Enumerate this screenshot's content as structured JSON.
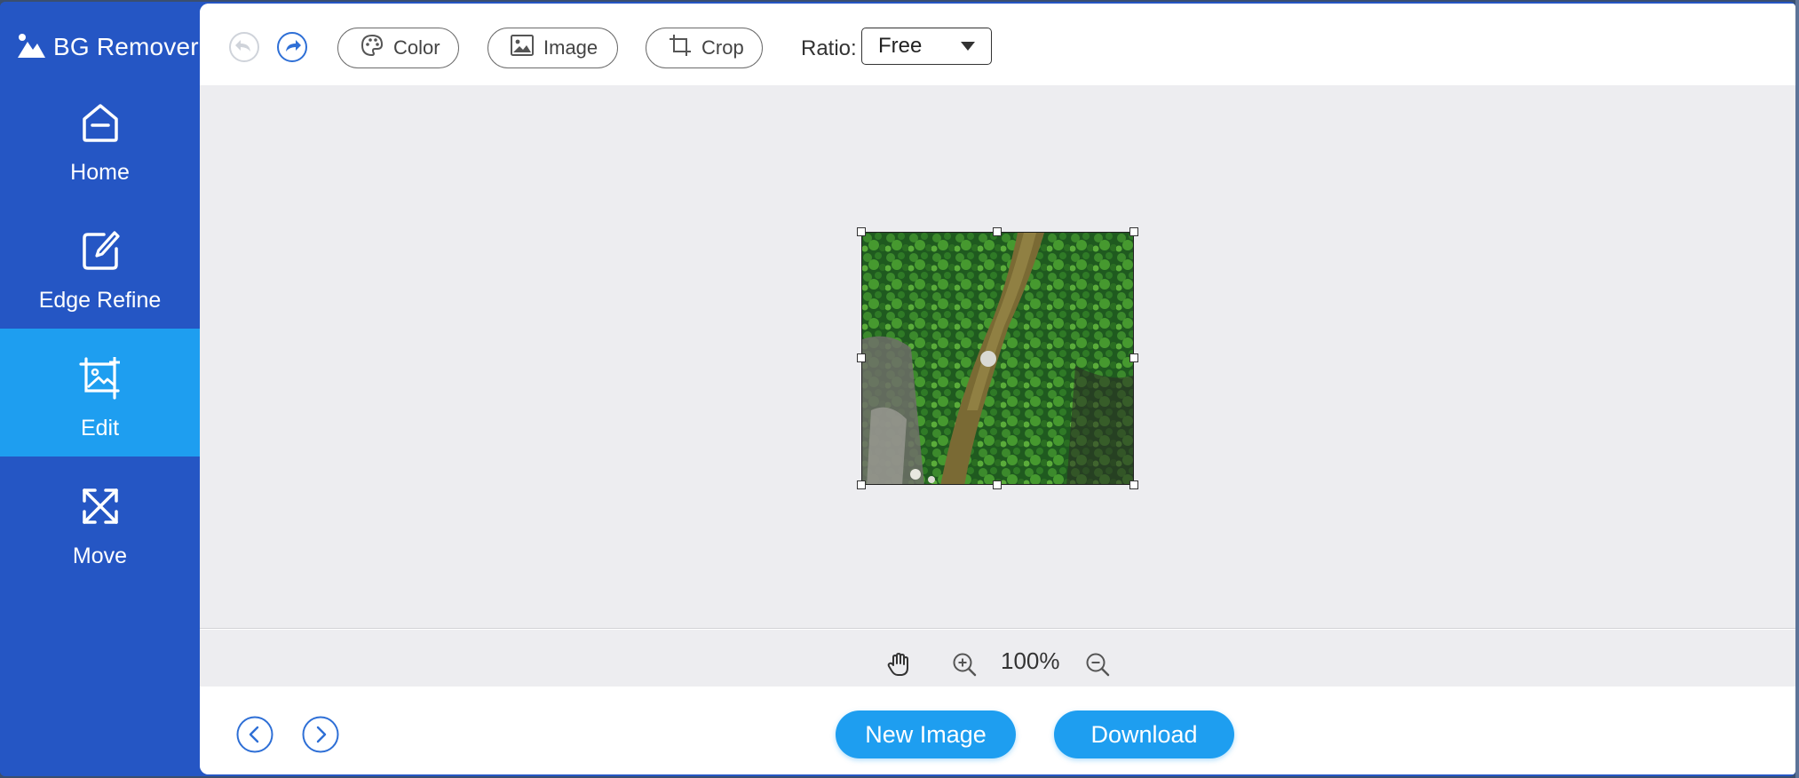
{
  "app": {
    "title": "BG Remover"
  },
  "sidebar": {
    "items": [
      {
        "label": "Home",
        "icon": "home-icon",
        "active": false
      },
      {
        "label": "Edge Refine",
        "icon": "edge-refine-icon",
        "active": false
      },
      {
        "label": "Edit",
        "icon": "edit-image-icon",
        "active": true
      },
      {
        "label": "Move",
        "icon": "move-icon",
        "active": false
      }
    ]
  },
  "toolbar": {
    "undo_icon": "undo-icon",
    "redo_icon": "redo-icon",
    "color_label": "Color",
    "image_label": "Image",
    "crop_label": "Crop",
    "ratio_label": "Ratio:",
    "ratio_value": "Free"
  },
  "zoom": {
    "value": "100%"
  },
  "footer": {
    "new_image_label": "New Image",
    "download_label": "Download"
  },
  "colors": {
    "sidebar_bg": "#2556c4",
    "active_item_bg": "#1e9ef0",
    "accent": "#1e9ef0",
    "canvas_bg": "#ededf0"
  }
}
